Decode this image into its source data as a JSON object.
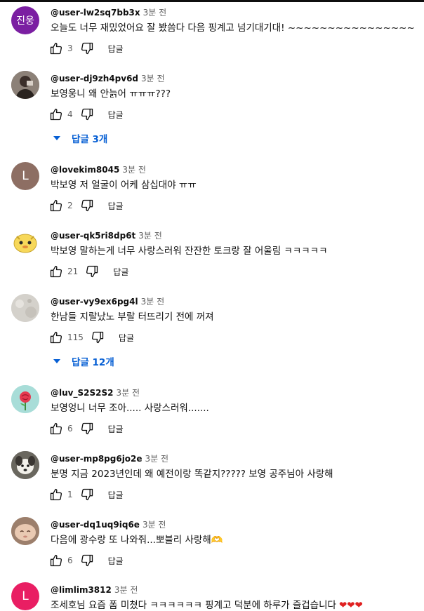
{
  "reply_label": "답글",
  "colors": {
    "link": "#065fd4",
    "meta": "#606060",
    "text": "#0f0f0f",
    "heart": "#e02020"
  },
  "comments": [
    {
      "avatar": {
        "type": "letters",
        "text": "진웅",
        "color": "#7b1fa2"
      },
      "author": "@user-lw2sq7bb3x",
      "time": "3분 전",
      "text": "오늘도 너무 재밌었어요 잘 봤씀다 다음 핑계고 넘기대기대! ~~~~~~~~~~~~~~~~",
      "likes": "3"
    },
    {
      "avatar": {
        "type": "photo",
        "icon": "person-photo-avatar"
      },
      "author": "@user-dj9zh4pv6d",
      "time": "3분 전",
      "text": "보영웅니 왜 안늙어 ㅠㅠㅠ???",
      "likes": "4",
      "replies": "답글 3개"
    },
    {
      "avatar": {
        "type": "letter",
        "text": "L",
        "color": "#8d6e63"
      },
      "author": "@lovekim8045",
      "time": "3분 전",
      "text": "박보영 저 얼굴이 어케 삼십대야 ㅠㅠ",
      "likes": "2"
    },
    {
      "avatar": {
        "type": "photo",
        "icon": "cartoon-face-avatar"
      },
      "author": "@user-qk5ri8dp6t",
      "time": "3분 전",
      "text": "박보영 말하는게 너무 사랑스러워 잔잔한 토크랑 잘 어울림 ㅋㅋㅋㅋㅋ",
      "likes": "21"
    },
    {
      "avatar": {
        "type": "photo",
        "icon": "gray-texture-avatar"
      },
      "author": "@user-vy9ex6pg4l",
      "time": "3분 전",
      "text": "한남들 지랄났노 부랄 터뜨리기 전에 꺼져",
      "likes": "115",
      "replies": "답글 12개"
    },
    {
      "avatar": {
        "type": "photo",
        "icon": "rose-avatar"
      },
      "author": "@luv_S2S2S2",
      "time": "3분 전",
      "text": "보영엉니 너무 조아..... 사랑스러워.......",
      "likes": "6"
    },
    {
      "avatar": {
        "type": "photo",
        "icon": "dog-photo-avatar"
      },
      "author": "@user-mp8pg6jo2e",
      "time": "3분 전",
      "text": "분명 지금 2023년인데 왜 예전이랑 똑같지????? 보영 공주님아 사랑해",
      "likes": "1"
    },
    {
      "avatar": {
        "type": "photo",
        "icon": "baby-photo-avatar"
      },
      "author": "@user-dq1uq9iq6e",
      "time": "3분 전",
      "text": "다음에 광수랑 또 나와줘...뽀블리 사랑해🫶",
      "likes": "6"
    },
    {
      "avatar": {
        "type": "letter",
        "text": "L",
        "color": "#e91e63"
      },
      "author": "@limlim3812",
      "time": "3분 전",
      "text": "조세호님 요즘 폼 미쳤다 ㅋㅋㅋㅋㅋㅋ 핑계고 덕분에 하루가 즐겁습니다",
      "hearts": "❤❤❤"
    }
  ]
}
